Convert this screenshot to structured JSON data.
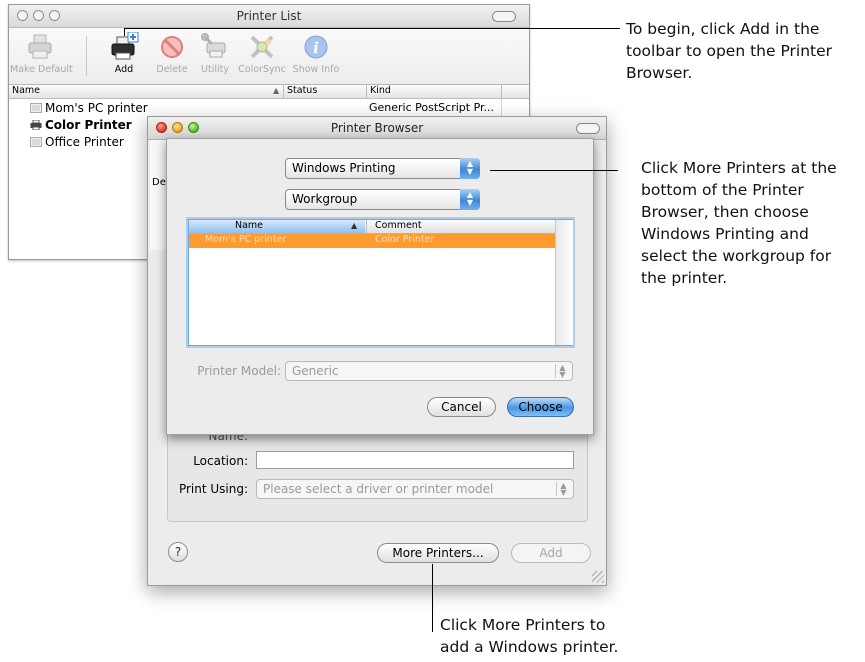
{
  "printer_list": {
    "title": "Printer List",
    "toolbar": [
      {
        "label": "Make Default",
        "icon": "make-default-icon",
        "enabled": false
      },
      {
        "label": "Add",
        "icon": "add-printer-icon",
        "enabled": true
      },
      {
        "label": "Delete",
        "icon": "delete-icon",
        "enabled": false
      },
      {
        "label": "Utility",
        "icon": "utility-icon",
        "enabled": false
      },
      {
        "label": "ColorSync",
        "icon": "colorsync-icon",
        "enabled": false
      },
      {
        "label": "Show Info",
        "icon": "info-icon",
        "enabled": false
      }
    ],
    "columns": {
      "name": "Name",
      "status": "Status",
      "kind": "Kind"
    },
    "rows": [
      {
        "name": "Mom's PC printer",
        "kind": "Generic PostScript Pr..."
      },
      {
        "name": "Color Printer",
        "kind": ""
      },
      {
        "name": "Office Printer",
        "kind": ""
      }
    ],
    "bg_fragment": "De"
  },
  "printer_browser": {
    "title": "Printer Browser",
    "name_label": "Name:",
    "location_label": "Location:",
    "location_value": "",
    "print_using_label": "Print Using:",
    "print_using_value": "Please select a driver or printer model",
    "help_label": "?",
    "more_printers_label": "More Printers...",
    "add_label": "Add"
  },
  "sheet": {
    "connection_value": "Windows Printing",
    "workgroup_value": "Workgroup",
    "columns": {
      "name": "Name",
      "comment": "Comment"
    },
    "rows": [
      {
        "name": "Mom's PC printer",
        "comment": "Color Printer"
      }
    ],
    "printer_model_label": "Printer Model:",
    "printer_model_value": "Generic",
    "cancel_label": "Cancel",
    "choose_label": "Choose"
  },
  "callouts": {
    "add": [
      "To begin, click Add in the",
      "toolbar to open the Printer",
      "Browser."
    ],
    "more_printers_right": [
      "Click More Printers at the",
      "bottom of the Printer",
      "Browser, then choose",
      "Windows Printing and",
      "select the workgroup for",
      "the printer."
    ],
    "more_printers_bottom": [
      "Click More Printers to",
      "add a Windows printer."
    ]
  },
  "colors": {
    "selection": "#ff9a2e",
    "aqua_blue": "#4b96e3"
  }
}
